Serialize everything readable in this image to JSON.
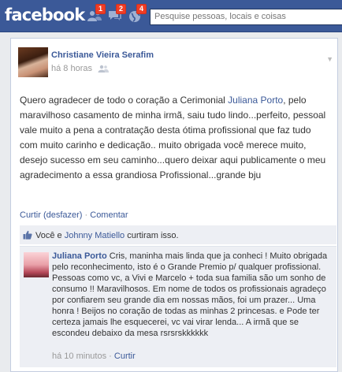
{
  "topbar": {
    "logo": "facebook",
    "friend_requests_count": "1",
    "messages_count": "2",
    "notifications_count": "4",
    "search_placeholder": "Pesquise pessoas, locais e coisas"
  },
  "post": {
    "author": "Christiane Vieira Serafim",
    "time": "há 8 horas",
    "audience_icon": "friends-icon",
    "body_before_link": "Quero agradecer de todo o coração a Cerimonial ",
    "body_link": "Juliana Porto",
    "body_after_link": ", pelo maravilhoso casamento de minha irmã, saiu tudo lindo...perfeito, pessoal vale muito a pena a contratação desta ótima profissional que faz tudo com muito carinho e dedicação.. muito obrigada você merece muito, desejo sucesso em seu caminho...quero deixar aqui publicamente o meu agradecimento a essa grandiosa Profissional...grande bju",
    "actions": {
      "unlike": "Curtir (desfazer)",
      "separator": " · ",
      "comment": "Comentar"
    },
    "likes": {
      "prefix": "Você e ",
      "name": "Johnny Matiello",
      "suffix": " curtiram isso."
    }
  },
  "comment": {
    "author": "Juliana Porto",
    "text": "Cris, maninha mais linda que ja conheci ! Muito obrigada pelo reconhecimento, isto é o Grande Premio p/ qualquer profissional. Pessoas como vc, a Vivi e Marcelo + toda sua familia são um sonho de consumo !! Maravilhosos. Em nome de todos os profissionais agradeço por confiarem seu grande dia em nossas mãos, foi um prazer... Uma honra ! Beijos no coração de todas as minhas 2 princesas. e Pode ter certeza jamais lhe esquecerei, vc vai virar lenda... A irmã que se escondeu debaixo da mesa rsrsrskkkkkk",
    "time": "há 10 minutos",
    "separator": " · ",
    "like_action": "Curtir"
  },
  "colors": {
    "brand_blue": "#3b5998",
    "badge_red": "#f03d25",
    "ufi_background": "#edeff4"
  }
}
